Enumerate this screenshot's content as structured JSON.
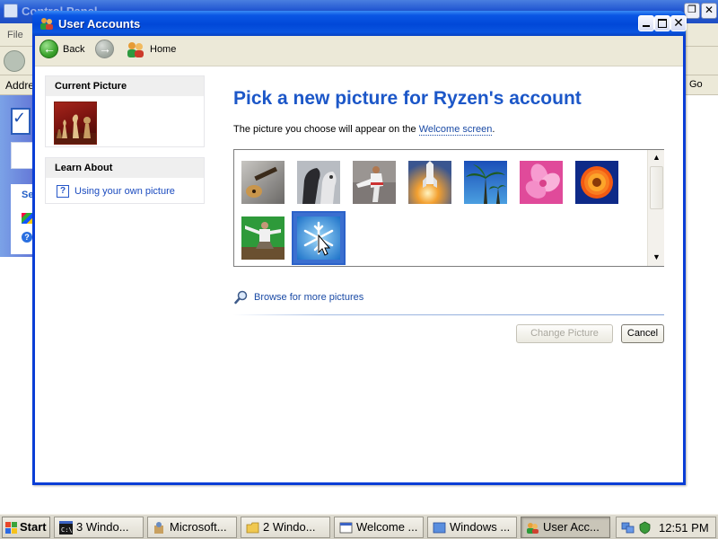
{
  "background_window": {
    "title": "Control Panel",
    "menu_file": "File",
    "address_label": "Address",
    "go_label": "Go",
    "see_also_label": "See"
  },
  "window": {
    "title": "User Accounts"
  },
  "nav": {
    "back_label": "Back",
    "home_label": "Home"
  },
  "sidebar": {
    "current_picture_header": "Current Picture",
    "learn_about_header": "Learn About",
    "learn_link": "Using your own picture"
  },
  "main": {
    "title": "Pick a new picture for Ryzen's account",
    "description_prefix": "The picture you choose will appear on the ",
    "description_link": "Welcome screen",
    "description_suffix": ".",
    "browse_link": "Browse for more pictures",
    "change_picture_button": "Change Picture",
    "cancel_button": "Cancel",
    "pictures": [
      {
        "name": "guitar",
        "selected": false
      },
      {
        "name": "horses",
        "selected": false
      },
      {
        "name": "karate",
        "selected": false
      },
      {
        "name": "space-shuttle",
        "selected": false
      },
      {
        "name": "palm-trees",
        "selected": false
      },
      {
        "name": "pink-flower",
        "selected": false
      },
      {
        "name": "orange-flower",
        "selected": false
      },
      {
        "name": "skateboarder",
        "selected": false
      },
      {
        "name": "snowflake",
        "selected": true
      }
    ]
  },
  "taskbar": {
    "start_label": "Start",
    "tasks": [
      {
        "label": "3 Windo...",
        "icon": "cmd-icon",
        "active": false
      },
      {
        "label": "Microsoft...",
        "icon": "tools-icon",
        "active": false
      },
      {
        "label": "2 Windo...",
        "icon": "folder-icon",
        "active": false
      },
      {
        "label": "Welcome ...",
        "icon": "welcome-icon",
        "active": false
      },
      {
        "label": "Windows ...",
        "icon": "windows-icon",
        "active": false
      },
      {
        "label": "User Acc...",
        "icon": "user-accounts-icon",
        "active": true
      }
    ],
    "clock": "12:51 PM"
  }
}
